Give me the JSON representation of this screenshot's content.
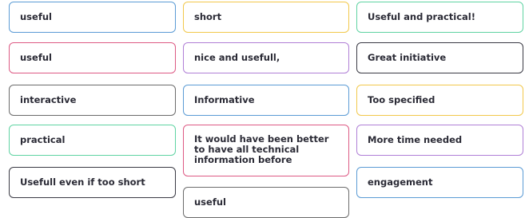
{
  "palette": {
    "blue": "#5b9bd5",
    "yellow": "#f2c84b",
    "green": "#5fd3a2",
    "pink": "#dd5a84",
    "purple": "#b07fd6",
    "gray": "#6b6b6b",
    "dark": "#3a3a44"
  },
  "columns": [
    {
      "cards": [
        {
          "text": "useful",
          "border": "#5b9bd5"
        },
        {
          "text": "useful",
          "border": "#dd5a84"
        },
        {
          "text": "interactive",
          "border": "#6b6b6b"
        },
        {
          "text": "practical",
          "border": "#5fd3a2"
        },
        {
          "text": "Usefull even if too short",
          "border": "#3a3a44"
        }
      ]
    },
    {
      "cards": [
        {
          "text": "short",
          "border": "#f2c84b"
        },
        {
          "text": "nice and usefull,",
          "border": "#b07fd6"
        },
        {
          "text": "Informative",
          "border": "#5b9bd5"
        },
        {
          "text": "It would have been better to have all technical information before",
          "border": "#dd5a84"
        },
        {
          "text": "useful",
          "border": "#6b6b6b"
        }
      ]
    },
    {
      "cards": [
        {
          "text": "Useful and practical!",
          "border": "#5fd3a2"
        },
        {
          "text": "Great initiative",
          "border": "#3a3a44"
        },
        {
          "text": "Too specified",
          "border": "#f2c84b"
        },
        {
          "text": "More time needed",
          "border": "#b07fd6"
        },
        {
          "text": "engagement",
          "border": "#5b9bd5"
        }
      ]
    }
  ]
}
